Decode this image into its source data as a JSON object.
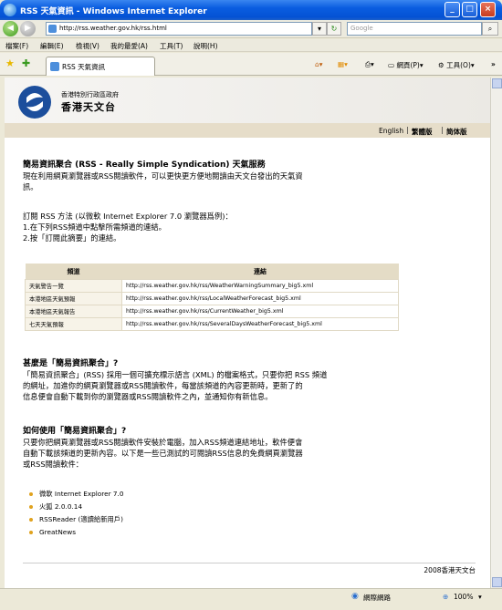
{
  "window": {
    "title": "RSS 天氣資訊 - Windows Internet Explorer"
  },
  "toolbar": {
    "address": "http://rss.weather.gov.hk/rss.html",
    "search_placeholder": "Google"
  },
  "menu": [
    "檔案(F)",
    "編輯(E)",
    "檢視(V)",
    "我的最愛(A)",
    "工具(T)",
    "說明(H)"
  ],
  "tab": {
    "label": "RSS 天氣資訊"
  },
  "command_bar": {
    "page": "網頁(P)",
    "tools": "工具(O)"
  },
  "header": {
    "org_small": "香港特別行政區政府",
    "org_big": "香港天文台",
    "languages": [
      "English",
      "繁體版",
      "简体版"
    ]
  },
  "intro": {
    "heading": "簡易資訊聚合 (RSS - Really Simple Syndication) 天氣服務",
    "lines": [
      "現在利用網頁瀏覽器或RSS閱讀軟件，可以更快更方便地閱讀由天文台發出的天氣資",
      "訊。"
    ]
  },
  "subscribe": {
    "lines": [
      "訂閱 RSS 方法 (以微軟 Internet Explorer 7.0 瀏覽器爲例)：",
      "1.在下列RSS頻道中點擊所需頻道的連結。",
      "2.按「訂閱此摘要」的連結。"
    ]
  },
  "table": {
    "headers": [
      "頻道",
      "連結"
    ],
    "rows": [
      {
        "channel": "天氣警告一覽",
        "link": "http://rss.weather.gov.hk/rss/WeatherWarningSummary_big5.xml"
      },
      {
        "channel": "本港地區天氣預報",
        "link": "http://rss.weather.gov.hk/rss/LocalWeatherForecast_big5.xml"
      },
      {
        "channel": "本港地區天氣報告",
        "link": "http://rss.weather.gov.hk/rss/CurrentWeather_big5.xml"
      },
      {
        "channel": "七天天氣預報",
        "link": "http://rss.weather.gov.hk/rss/SeveralDaysWeatherForecast_big5.xml"
      }
    ]
  },
  "what_is": {
    "heading": "甚麼是「簡易資訊聚合」?",
    "lines": [
      "「簡易資訊聚合」(RSS) 採用一個可擴充標示語言 (XML) 的檔案格式，只要你把 RSS 頻道",
      "的網址，加進你的網頁瀏覽器或RSS閱讀軟件，每當該頻道的內容更新時，更新了的",
      "信息便會自動下載到你的瀏覽器或RSS閱讀軟件之內，並通知你有新信息。"
    ]
  },
  "how_to": {
    "heading": "如何使用「簡易資訊聚合」?",
    "lines": [
      "只要你把網頁瀏覽器或RSS閱讀軟件安裝於電腦，加入RSS頻道連結地址，軟件便會",
      "自動下載該頻道的更新內容。以下是一些已測試的可閱讀RSS信息的免費網頁瀏覽器",
      "或RSS閱讀軟件："
    ],
    "software": [
      "微軟 Internet Explorer 7.0",
      "火狐 2.0.0.14",
      "RSSReader (適讀給新用戶)",
      "GreatNews"
    ]
  },
  "footer": {
    "text": "2008香港天文台"
  },
  "status": {
    "zone": "網際網路",
    "zoom": "100%"
  },
  "colors": {
    "titlebar": "#0a5de0",
    "lang_bar": "#e6ddc9",
    "table_header": "#e4dcc6",
    "bullet": "#e0a21e"
  }
}
